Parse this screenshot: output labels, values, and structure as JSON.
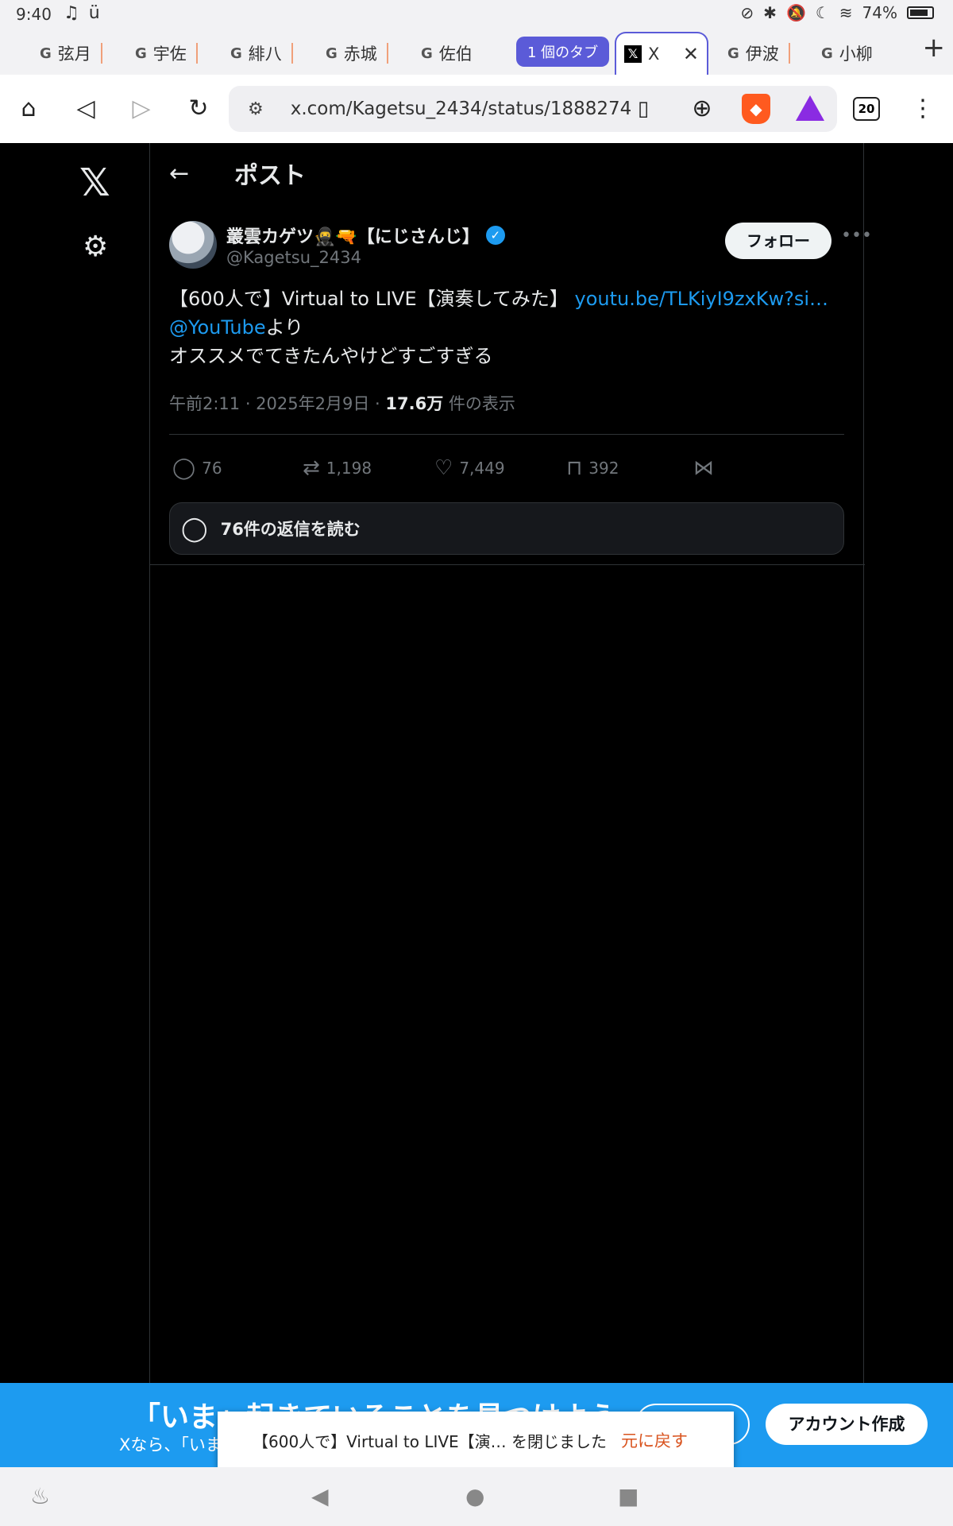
{
  "status_bar": {
    "time": "9:40",
    "battery": "74%"
  },
  "tabs": [
    {
      "label": "弦月"
    },
    {
      "label": "宇佐"
    },
    {
      "label": "緋八"
    },
    {
      "label": "赤城"
    },
    {
      "label": "佐伯"
    },
    {
      "label": "1 個のタブ"
    },
    {
      "label": "X"
    },
    {
      "label": "伊波"
    },
    {
      "label": "小柳"
    }
  ],
  "browser": {
    "url": "x.com/Kagetsu_2434/status/1888274",
    "tab_count": "20"
  },
  "post": {
    "header_title": "ポスト",
    "author_name": "叢雲カゲツ🥷🔫【にじさんじ】",
    "handle": "@Kagetsu_2434",
    "follow_label": "フォロー",
    "text_line1": "【600人で】Virtual to LIVE【演奏してみた】 ",
    "link_text": "youtu.be/TLKiyI9zxKw?si…",
    "mention": "@YouTube",
    "text_after_mention": "より",
    "text_line3": "オススメでてきたんやけどすごすぎる",
    "time": "午前2:11 · 2025年2月9日 · ",
    "views_count": "17.6万",
    "views_label": " 件の表示",
    "replies": "76",
    "reposts": "1,198",
    "likes": "7,449",
    "bookmarks": "392",
    "read_replies_label": "76件の返信を読む"
  },
  "banner": {
    "headline": "「いま」起きていることを見つけよう",
    "sub": "Xなら、「いま」",
    "signup_label": "アカウント作成"
  },
  "snackbar": {
    "message": "【600人で】Virtual to LIVE【演… を閉じました",
    "undo_label": "元に戻す"
  }
}
